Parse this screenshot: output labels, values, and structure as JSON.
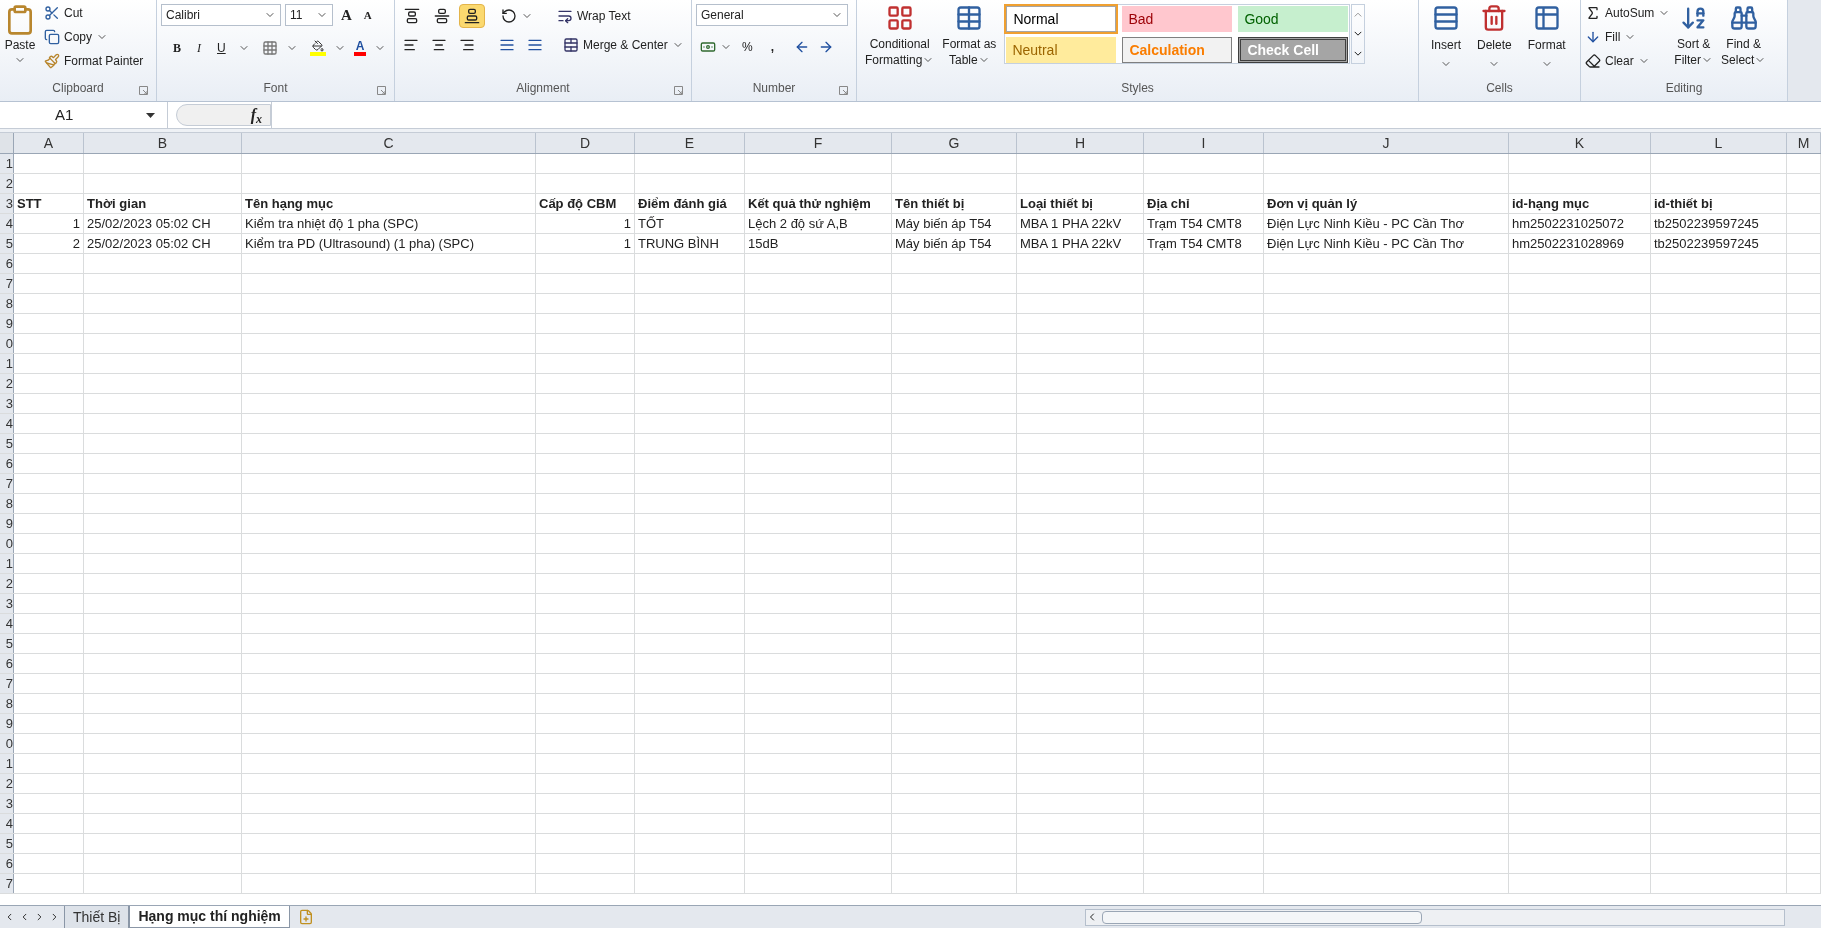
{
  "ribbon": {
    "clipboard": {
      "label": "Clipboard",
      "paste": "Paste",
      "cut": "Cut",
      "copy": "Copy",
      "format_painter": "Format Painter"
    },
    "font": {
      "label": "Font",
      "font_name": "Calibri",
      "font_size": "11",
      "grow": "A",
      "shrink": "A",
      "bold": "B",
      "italic": "I",
      "underline": "U",
      "font_color": "A"
    },
    "alignment": {
      "label": "Alignment",
      "vertical": [
        {
          "selected": false
        },
        {
          "selected": false
        },
        {
          "selected": true
        }
      ],
      "wrap_text": "Wrap Text",
      "merge_center": "Merge & Center"
    },
    "number": {
      "label": "Number",
      "format": "General",
      "percent": "%",
      "comma": ","
    },
    "styles": {
      "label": "Styles",
      "conditional": [
        "Conditional",
        "Formatting"
      ],
      "format_table": [
        "Format as",
        "Table"
      ],
      "cells": [
        {
          "label": "Normal",
          "kind": "normal",
          "selected": true
        },
        {
          "label": "Bad",
          "kind": "bad",
          "selected": false
        },
        {
          "label": "Good",
          "kind": "good",
          "selected": false
        },
        {
          "label": "Neutral",
          "kind": "neutral",
          "selected": false
        },
        {
          "label": "Calculation",
          "kind": "calculation",
          "selected": false
        },
        {
          "label": "Check Cell",
          "kind": "check",
          "selected": false
        }
      ]
    },
    "cells": {
      "label": "Cells",
      "buttons": [
        {
          "label": "Insert",
          "kind": "insert"
        },
        {
          "label": "Delete",
          "kind": "delete"
        },
        {
          "label": "Format",
          "kind": "format"
        }
      ]
    },
    "editing": {
      "label": "Editing",
      "autosum": "AutoSum",
      "fill": "Fill",
      "clear": "Clear",
      "sort_filter": [
        "Sort &",
        "Filter"
      ],
      "find_select": [
        "Find &",
        "Select"
      ]
    }
  },
  "formula_bar": {
    "name_box": "A1",
    "function_label": "f$_{x}$"
  },
  "columns": [
    "A",
    "B",
    "C",
    "D",
    "E",
    "F",
    "G",
    "H",
    "I",
    "J",
    "K",
    "L",
    "M"
  ],
  "rows": [
    {
      "label": "1"
    },
    {
      "label": "2"
    },
    {
      "label": "3",
      "kind": "header",
      "cells": [
        {
          "value": "STT",
          "kind": "text"
        },
        {
          "value": "Thời gian",
          "kind": "text"
        },
        {
          "value": "Tên hạng mục",
          "kind": "text"
        },
        {
          "value": "Cấp độ CBM",
          "kind": "text"
        },
        {
          "value": "Điểm đánh giá",
          "kind": "text"
        },
        {
          "value": "Kết quả thử nghiệm",
          "kind": "text"
        },
        {
          "value": "Tên thiết bị",
          "kind": "text"
        },
        {
          "value": "Loại thiết bị",
          "kind": "text"
        },
        {
          "value": "Địa chỉ",
          "kind": "text"
        },
        {
          "value": "Đơn vị quản lý",
          "kind": "text"
        },
        {
          "value": "id-hạng mục",
          "kind": "text"
        },
        {
          "value": "id-thiết bị",
          "kind": "text"
        }
      ]
    },
    {
      "label": "4",
      "kind": "data",
      "cells": [
        {
          "value": "1",
          "kind": "number"
        },
        {
          "value": "25/02/2023 05:02 CH",
          "kind": "text"
        },
        {
          "value": "Kiểm tra nhiệt độ 1 pha (SPC)",
          "kind": "text"
        },
        {
          "value": "1",
          "kind": "number"
        },
        {
          "value": "TỐT",
          "kind": "text"
        },
        {
          "value": "Lệch 2 độ sứ A,B",
          "kind": "text"
        },
        {
          "value": "Máy biến áp T54",
          "kind": "text"
        },
        {
          "value": "MBA 1 PHA 22kV",
          "kind": "text"
        },
        {
          "value": "Trạm T54 CMT8",
          "kind": "text"
        },
        {
          "value": "Điện Lực Ninh Kiều - PC Cần Thơ",
          "kind": "text"
        },
        {
          "value": "hm2502231025072",
          "kind": "text"
        },
        {
          "value": "tb2502239597245",
          "kind": "text"
        }
      ]
    },
    {
      "label": "5",
      "kind": "data",
      "cells": [
        {
          "value": "2",
          "kind": "number"
        },
        {
          "value": "25/02/2023 05:02 CH",
          "kind": "text"
        },
        {
          "value": "Kiểm tra PD (Ultrasound) (1 pha) (SPC)",
          "kind": "text"
        },
        {
          "value": "1",
          "kind": "number"
        },
        {
          "value": "TRUNG BÌNH",
          "kind": "text"
        },
        {
          "value": "15dB",
          "kind": "text"
        },
        {
          "value": "Máy biến áp T54",
          "kind": "text"
        },
        {
          "value": "MBA 1 PHA 22kV",
          "kind": "text"
        },
        {
          "value": "Trạm T54 CMT8",
          "kind": "text"
        },
        {
          "value": "Điện Lực Ninh Kiều - PC Cần Thơ",
          "kind": "text"
        },
        {
          "value": "hm2502231028969",
          "kind": "text"
        },
        {
          "value": "tb2502239597245",
          "kind": "text"
        }
      ]
    },
    {
      "label": "6"
    },
    {
      "label": "7"
    },
    {
      "label": "8"
    },
    {
      "label": "9"
    },
    {
      "label": "0"
    },
    {
      "label": "1"
    },
    {
      "label": "2"
    },
    {
      "label": "3"
    },
    {
      "label": "4"
    },
    {
      "label": "5"
    },
    {
      "label": "6"
    },
    {
      "label": "7"
    },
    {
      "label": "8"
    },
    {
      "label": "9"
    },
    {
      "label": "0"
    },
    {
      "label": "1"
    },
    {
      "label": "2"
    },
    {
      "label": "3"
    },
    {
      "label": "4"
    },
    {
      "label": "5"
    },
    {
      "label": "6"
    },
    {
      "label": "7"
    },
    {
      "label": "8"
    },
    {
      "label": "9"
    },
    {
      "label": "0"
    },
    {
      "label": "1"
    },
    {
      "label": "2"
    },
    {
      "label": "3"
    },
    {
      "label": "4"
    },
    {
      "label": "5"
    },
    {
      "label": "6"
    },
    {
      "label": "7"
    }
  ],
  "sheet_tabs": [
    {
      "label": "Thiết Bị",
      "selected": false
    },
    {
      "label": "Hạng mục thí nghiệm",
      "selected": true
    }
  ]
}
